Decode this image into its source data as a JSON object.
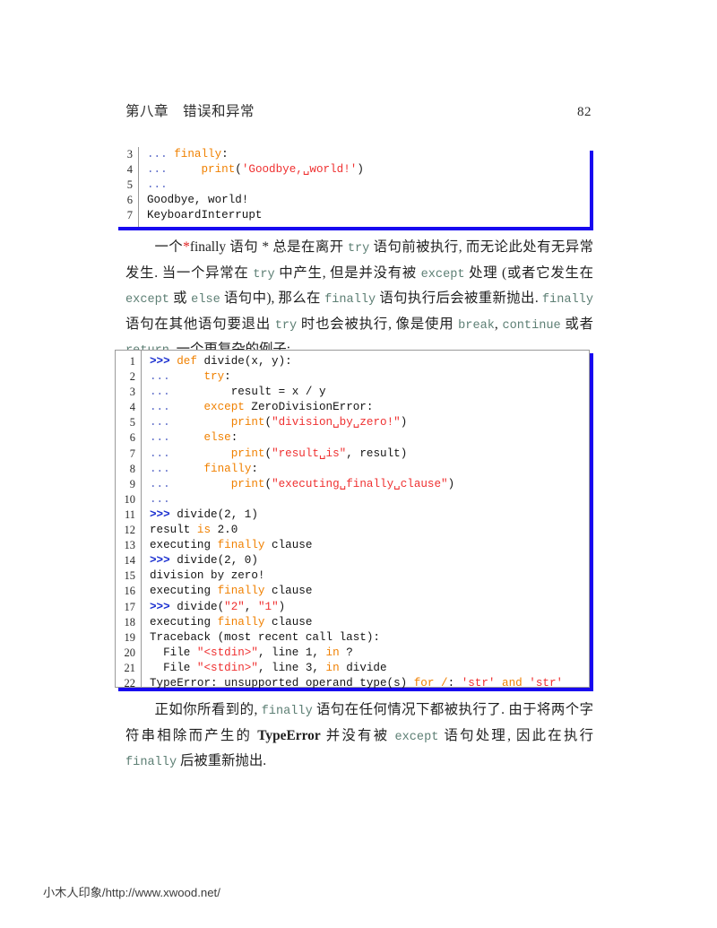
{
  "header": {
    "chapter": "第八章　错误和异常",
    "page_number": "82"
  },
  "code_block_1": {
    "line_numbers": [
      "3",
      "4",
      "5",
      "6",
      "7"
    ],
    "lines": [
      [
        {
          "t": "... ",
          "c": "dt"
        },
        {
          "t": "finally",
          "c": "k"
        },
        {
          "t": ":",
          "c": "pl"
        }
      ],
      [
        {
          "t": "... ",
          "c": "dt"
        },
        {
          "t": "    ",
          "c": "pl"
        },
        {
          "t": "print",
          "c": "k"
        },
        {
          "t": "(",
          "c": "pl"
        },
        {
          "t": "'Goodbye,␣world!'",
          "c": "s"
        },
        {
          "t": ")",
          "c": "pl"
        }
      ],
      [
        {
          "t": "...",
          "c": "dt"
        }
      ],
      [
        {
          "t": "Goodbye, world!",
          "c": "pl"
        }
      ],
      [
        {
          "t": "KeyboardInterrupt",
          "c": "pl"
        }
      ]
    ]
  },
  "paragraph_1": {
    "runs": [
      {
        "t": "一个",
        "c": "serif"
      },
      {
        "t": "*",
        "c": "red-star"
      },
      {
        "t": "finally",
        "c": "serif"
      },
      {
        "t": " 语句 * 总是在离开 ",
        "c": "serif"
      },
      {
        "t": "try",
        "c": "mono"
      },
      {
        "t": " 语句前被执行, 而无论此处有无异常发生. 当一个异常在 ",
        "c": "serif"
      },
      {
        "t": "try",
        "c": "mono"
      },
      {
        "t": " 中产生, 但是并没有被 ",
        "c": "serif"
      },
      {
        "t": "except",
        "c": "mono"
      },
      {
        "t": " 处理 (或者它发生在 ",
        "c": "serif"
      },
      {
        "t": "except",
        "c": "mono"
      },
      {
        "t": " 或 ",
        "c": "serif"
      },
      {
        "t": "else",
        "c": "mono"
      },
      {
        "t": " 语句中), 那么在 ",
        "c": "serif"
      },
      {
        "t": "finally",
        "c": "mono"
      },
      {
        "t": " 语句执行后会被重新抛出. ",
        "c": "serif"
      },
      {
        "t": "finally",
        "c": "mono"
      },
      {
        "t": " 语句在其他语句要退出 ",
        "c": "serif"
      },
      {
        "t": "try",
        "c": "mono"
      },
      {
        "t": " 时也会被执行, 像是使用 ",
        "c": "serif"
      },
      {
        "t": "break",
        "c": "mono"
      },
      {
        "t": ", ",
        "c": "serif"
      },
      {
        "t": "continue",
        "c": "mono"
      },
      {
        "t": " 或者 ",
        "c": "serif"
      },
      {
        "t": "return",
        "c": "mono"
      },
      {
        "t": ". 一个更复杂的例子:",
        "c": "serif"
      }
    ]
  },
  "code_block_2": {
    "line_numbers": [
      "1",
      "2",
      "3",
      "4",
      "5",
      "6",
      "7",
      "8",
      "9",
      "10",
      "11",
      "12",
      "13",
      "14",
      "15",
      "16",
      "17",
      "18",
      "19",
      "20",
      "21",
      "22"
    ],
    "lines": [
      [
        {
          "t": ">>> ",
          "c": "pr"
        },
        {
          "t": "def",
          "c": "k"
        },
        {
          "t": " divide(x, y):",
          "c": "pl"
        }
      ],
      [
        {
          "t": "... ",
          "c": "dt"
        },
        {
          "t": "    ",
          "c": "pl"
        },
        {
          "t": "try",
          "c": "k"
        },
        {
          "t": ":",
          "c": "pl"
        }
      ],
      [
        {
          "t": "... ",
          "c": "dt"
        },
        {
          "t": "        result = x / y",
          "c": "pl"
        }
      ],
      [
        {
          "t": "... ",
          "c": "dt"
        },
        {
          "t": "    ",
          "c": "pl"
        },
        {
          "t": "except",
          "c": "k"
        },
        {
          "t": " ZeroDivisionError:",
          "c": "pl"
        }
      ],
      [
        {
          "t": "... ",
          "c": "dt"
        },
        {
          "t": "        ",
          "c": "pl"
        },
        {
          "t": "print",
          "c": "k"
        },
        {
          "t": "(",
          "c": "pl"
        },
        {
          "t": "\"division␣by␣zero!\"",
          "c": "s"
        },
        {
          "t": ")",
          "c": "pl"
        }
      ],
      [
        {
          "t": "... ",
          "c": "dt"
        },
        {
          "t": "    ",
          "c": "pl"
        },
        {
          "t": "else",
          "c": "k"
        },
        {
          "t": ":",
          "c": "pl"
        }
      ],
      [
        {
          "t": "... ",
          "c": "dt"
        },
        {
          "t": "        ",
          "c": "pl"
        },
        {
          "t": "print",
          "c": "k"
        },
        {
          "t": "(",
          "c": "pl"
        },
        {
          "t": "\"result␣is\"",
          "c": "s"
        },
        {
          "t": ", result)",
          "c": "pl"
        }
      ],
      [
        {
          "t": "... ",
          "c": "dt"
        },
        {
          "t": "    ",
          "c": "pl"
        },
        {
          "t": "finally",
          "c": "k"
        },
        {
          "t": ":",
          "c": "pl"
        }
      ],
      [
        {
          "t": "... ",
          "c": "dt"
        },
        {
          "t": "        ",
          "c": "pl"
        },
        {
          "t": "print",
          "c": "k"
        },
        {
          "t": "(",
          "c": "pl"
        },
        {
          "t": "\"executing␣finally␣clause\"",
          "c": "s"
        },
        {
          "t": ")",
          "c": "pl"
        }
      ],
      [
        {
          "t": "...",
          "c": "dt"
        }
      ],
      [
        {
          "t": ">>> ",
          "c": "pr"
        },
        {
          "t": "divide(2, 1)",
          "c": "pl"
        }
      ],
      [
        {
          "t": "result ",
          "c": "pl"
        },
        {
          "t": "is",
          "c": "k"
        },
        {
          "t": " 2.0",
          "c": "pl"
        }
      ],
      [
        {
          "t": "executing ",
          "c": "pl"
        },
        {
          "t": "finally",
          "c": "k"
        },
        {
          "t": " clause",
          "c": "pl"
        }
      ],
      [
        {
          "t": ">>> ",
          "c": "pr"
        },
        {
          "t": "divide(2, 0)",
          "c": "pl"
        }
      ],
      [
        {
          "t": "division by zero!",
          "c": "pl"
        }
      ],
      [
        {
          "t": "executing ",
          "c": "pl"
        },
        {
          "t": "finally",
          "c": "k"
        },
        {
          "t": " clause",
          "c": "pl"
        }
      ],
      [
        {
          "t": ">>> ",
          "c": "pr"
        },
        {
          "t": "divide(",
          "c": "pl"
        },
        {
          "t": "\"2\"",
          "c": "s"
        },
        {
          "t": ", ",
          "c": "pl"
        },
        {
          "t": "\"1\"",
          "c": "s"
        },
        {
          "t": ")",
          "c": "pl"
        }
      ],
      [
        {
          "t": "executing ",
          "c": "pl"
        },
        {
          "t": "finally",
          "c": "k"
        },
        {
          "t": " clause",
          "c": "pl"
        }
      ],
      [
        {
          "t": "Traceback (most recent call last):",
          "c": "pl"
        }
      ],
      [
        {
          "t": "  File ",
          "c": "pl"
        },
        {
          "t": "\"<stdin>\"",
          "c": "s"
        },
        {
          "t": ", line 1, ",
          "c": "pl"
        },
        {
          "t": "in",
          "c": "k"
        },
        {
          "t": " ?",
          "c": "pl"
        }
      ],
      [
        {
          "t": "  File ",
          "c": "pl"
        },
        {
          "t": "\"<stdin>\"",
          "c": "s"
        },
        {
          "t": ", line 3, ",
          "c": "pl"
        },
        {
          "t": "in",
          "c": "k"
        },
        {
          "t": " divide",
          "c": "pl"
        }
      ],
      [
        {
          "t": "TypeError: unsupported operand type(s) ",
          "c": "pl"
        },
        {
          "t": "for",
          "c": "k"
        },
        {
          "t": " ",
          "c": "pl"
        },
        {
          "t": "/",
          "c": "k"
        },
        {
          "t": ": ",
          "c": "pl"
        },
        {
          "t": "'str'",
          "c": "s"
        },
        {
          "t": " ",
          "c": "pl"
        },
        {
          "t": "and",
          "c": "k"
        },
        {
          "t": " ",
          "c": "pl"
        },
        {
          "t": "'str'",
          "c": "s"
        }
      ]
    ]
  },
  "paragraph_2": {
    "runs": [
      {
        "t": "正如你所看到的, ",
        "c": "serif"
      },
      {
        "t": "finally",
        "c": "mono"
      },
      {
        "t": " 语句在任何情况下都被执行了. 由于将两个字符串相除而产生的 ",
        "c": "serif"
      },
      {
        "t": "TypeError",
        "c": "bold-serif"
      },
      {
        "t": " 并没有被 ",
        "c": "serif"
      },
      {
        "t": "except",
        "c": "mono"
      },
      {
        "t": " 语句处理, 因此在执行 ",
        "c": "serif"
      },
      {
        "t": "finally",
        "c": "mono"
      },
      {
        "t": " 后被重新抛出.",
        "c": "serif"
      }
    ]
  },
  "footer": {
    "watermark": "小木人印象/http://www.xwood.net/"
  },
  "colors": {
    "keyword": "#f08000",
    "string": "#ef3030",
    "prompt": "#1a2fd0",
    "shadow": "#1808f0",
    "inline_code": "#5d7f74",
    "red_star": "#e02020"
  }
}
